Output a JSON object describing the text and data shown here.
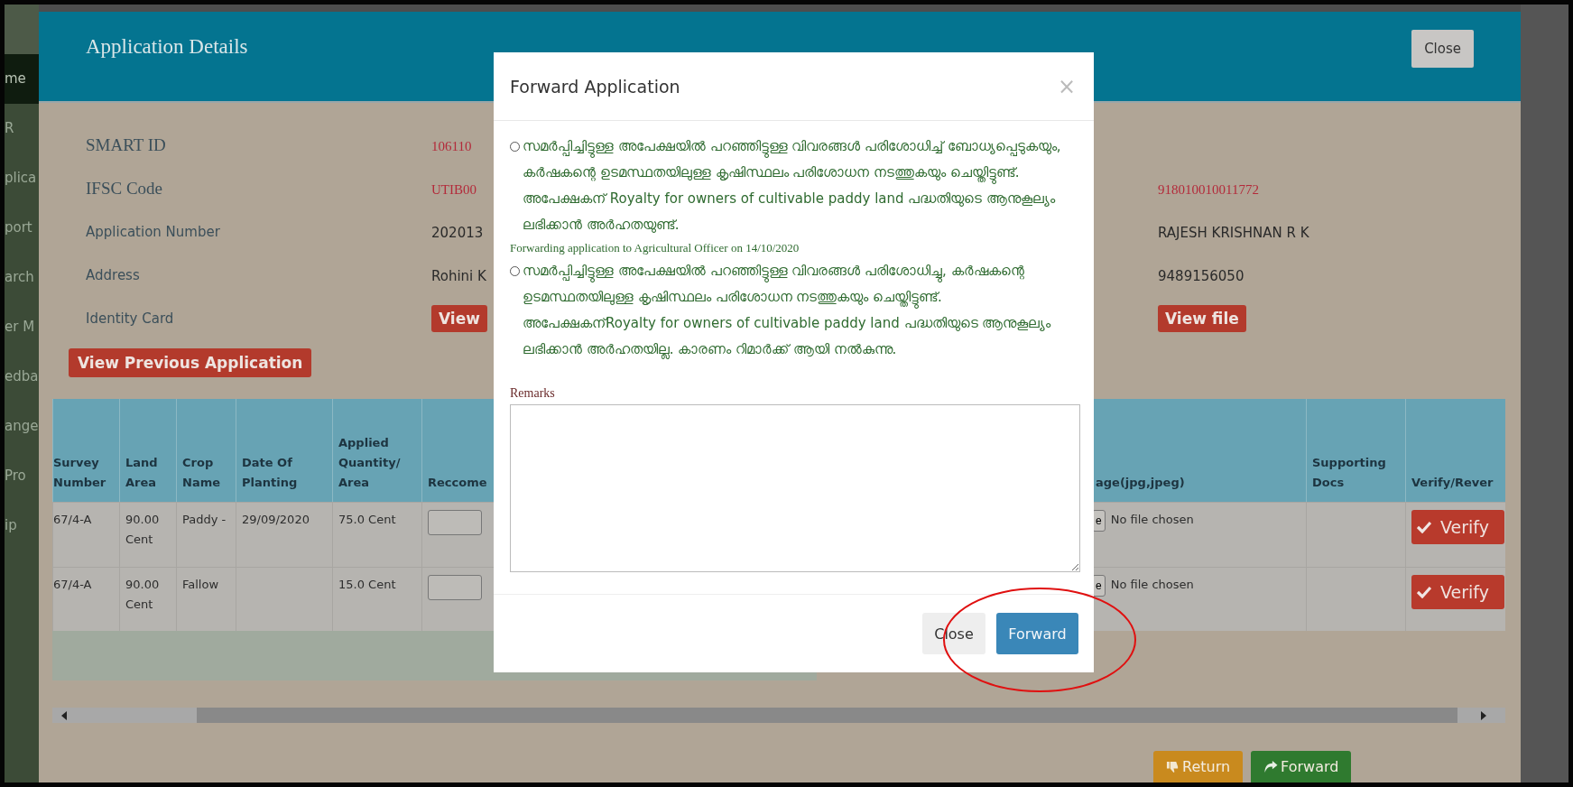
{
  "sidebar": {
    "items": [
      {
        "label": "me",
        "selected": true
      },
      {
        "label": "R",
        "selected": false
      },
      {
        "label": "plica",
        "selected": false
      },
      {
        "label": "port",
        "selected": false
      },
      {
        "label": "arch",
        "selected": false
      },
      {
        "label": "er M",
        "selected": false
      },
      {
        "label": "edba",
        "selected": false
      },
      {
        "label": "ange",
        "selected": false
      },
      {
        "label": "Pro",
        "selected": false
      },
      {
        "label": "ip",
        "selected": false
      }
    ]
  },
  "details_window": {
    "title": "Application Details",
    "close_button": "Close",
    "fields": [
      {
        "label": "SMART ID",
        "kind": "serif",
        "values": [
          {
            "kind": "accent",
            "text": "106110"
          }
        ]
      },
      {
        "label": "IFSC Code",
        "kind": "serif",
        "values": [
          {
            "kind": "accent",
            "text": "UTIB00"
          },
          {
            "kind": "accent",
            "text": "918010010011772"
          }
        ]
      },
      {
        "label": "Application Number",
        "kind": "sans",
        "values": [
          {
            "kind": "plain",
            "text": "202013"
          },
          {
            "kind": "plain",
            "text": "RAJESH KRISHNAN R K"
          }
        ]
      },
      {
        "label": "Address",
        "kind": "sans",
        "values": [
          {
            "kind": "plain",
            "text": "Rohini K"
          },
          {
            "kind": "plain",
            "text": "9489156050"
          }
        ]
      },
      {
        "label": "Identity Card",
        "kind": "sans",
        "values": [
          {
            "kind": "button",
            "text": "View"
          },
          {
            "kind": "button",
            "text": "View file"
          }
        ]
      }
    ],
    "previous_button": "View Previous Application",
    "table": {
      "columns": [
        "Survey Number",
        "Land Area",
        "Crop Name",
        "Date Of Planting",
        "Applied Quantity/ Area",
        "Reccome",
        "",
        "age(jpg,jpeg)",
        "Supporting Docs",
        "Verify/Rever"
      ],
      "rows": [
        {
          "survey": "67/4-A",
          "land_area": "90.00 Cent",
          "crop": "Paddy -",
          "date": "29/09/2020",
          "applied": "75.0 Cent",
          "file_button": "e",
          "file_status": "No file chosen",
          "verify": "Verify"
        },
        {
          "survey": "67/4-A",
          "land_area": "90.00 Cent",
          "crop": "Fallow",
          "date": "",
          "applied": "15.0 Cent",
          "file_button": "e",
          "file_status": "No file chosen",
          "verify": "Verify"
        }
      ]
    },
    "actions": [
      "Return",
      "Forward"
    ]
  },
  "forward_dialog": {
    "title": "Forward Application",
    "close_icon": "×",
    "options": [
      {
        "text": "സമർപ്പിച്ചിട്ടുള്ള അപേക്ഷയിൽ പറഞ്ഞിട്ടുള്ള വിവരങ്ങൾ പരിശോധിച്ച് ബോധ്യപ്പെടുകയും, കർഷകന്റെ ഉടമസ്ഥതയിലുള്ള കൃഷിസ്ഥലം പരിശോധന നടത്തുകയും ചെയ്തിട്ടുണ്ട്. അപേക്ഷകന് Royalty for owners of cultivable paddy land പദ്ധതിയുടെ ആനുകൂല്യം ലഭിക്കാൻ അർഹതയുണ്ട്.",
        "note": "Forwarding application to Agricultural Officer on 14/10/2020",
        "selected": false
      },
      {
        "text": "സമർപ്പിച്ചിട്ടുള്ള അപേക്ഷയിൽ പറഞ്ഞിട്ടുള്ള വിവരങ്ങൾ പരിശോധിച്ചു, കർഷകന്റെ ഉടമസ്ഥതയിലുള്ള കൃഷിസ്ഥലം പരിശോധന നടത്തുകയും ചെയ്തിട്ടുണ്ട്. അപേക്ഷകന്Royalty for owners of cultivable paddy land പദ്ധതിയുടെ ആനുകൂല്യം ലഭിക്കാൻ അർഹതയില്ല. കാരണം റിമാർക്ക് ആയി നൽകുന്നു.",
        "selected": false
      }
    ],
    "remarks_label": "Remarks",
    "buttons": [
      "Close",
      "Forward"
    ]
  }
}
